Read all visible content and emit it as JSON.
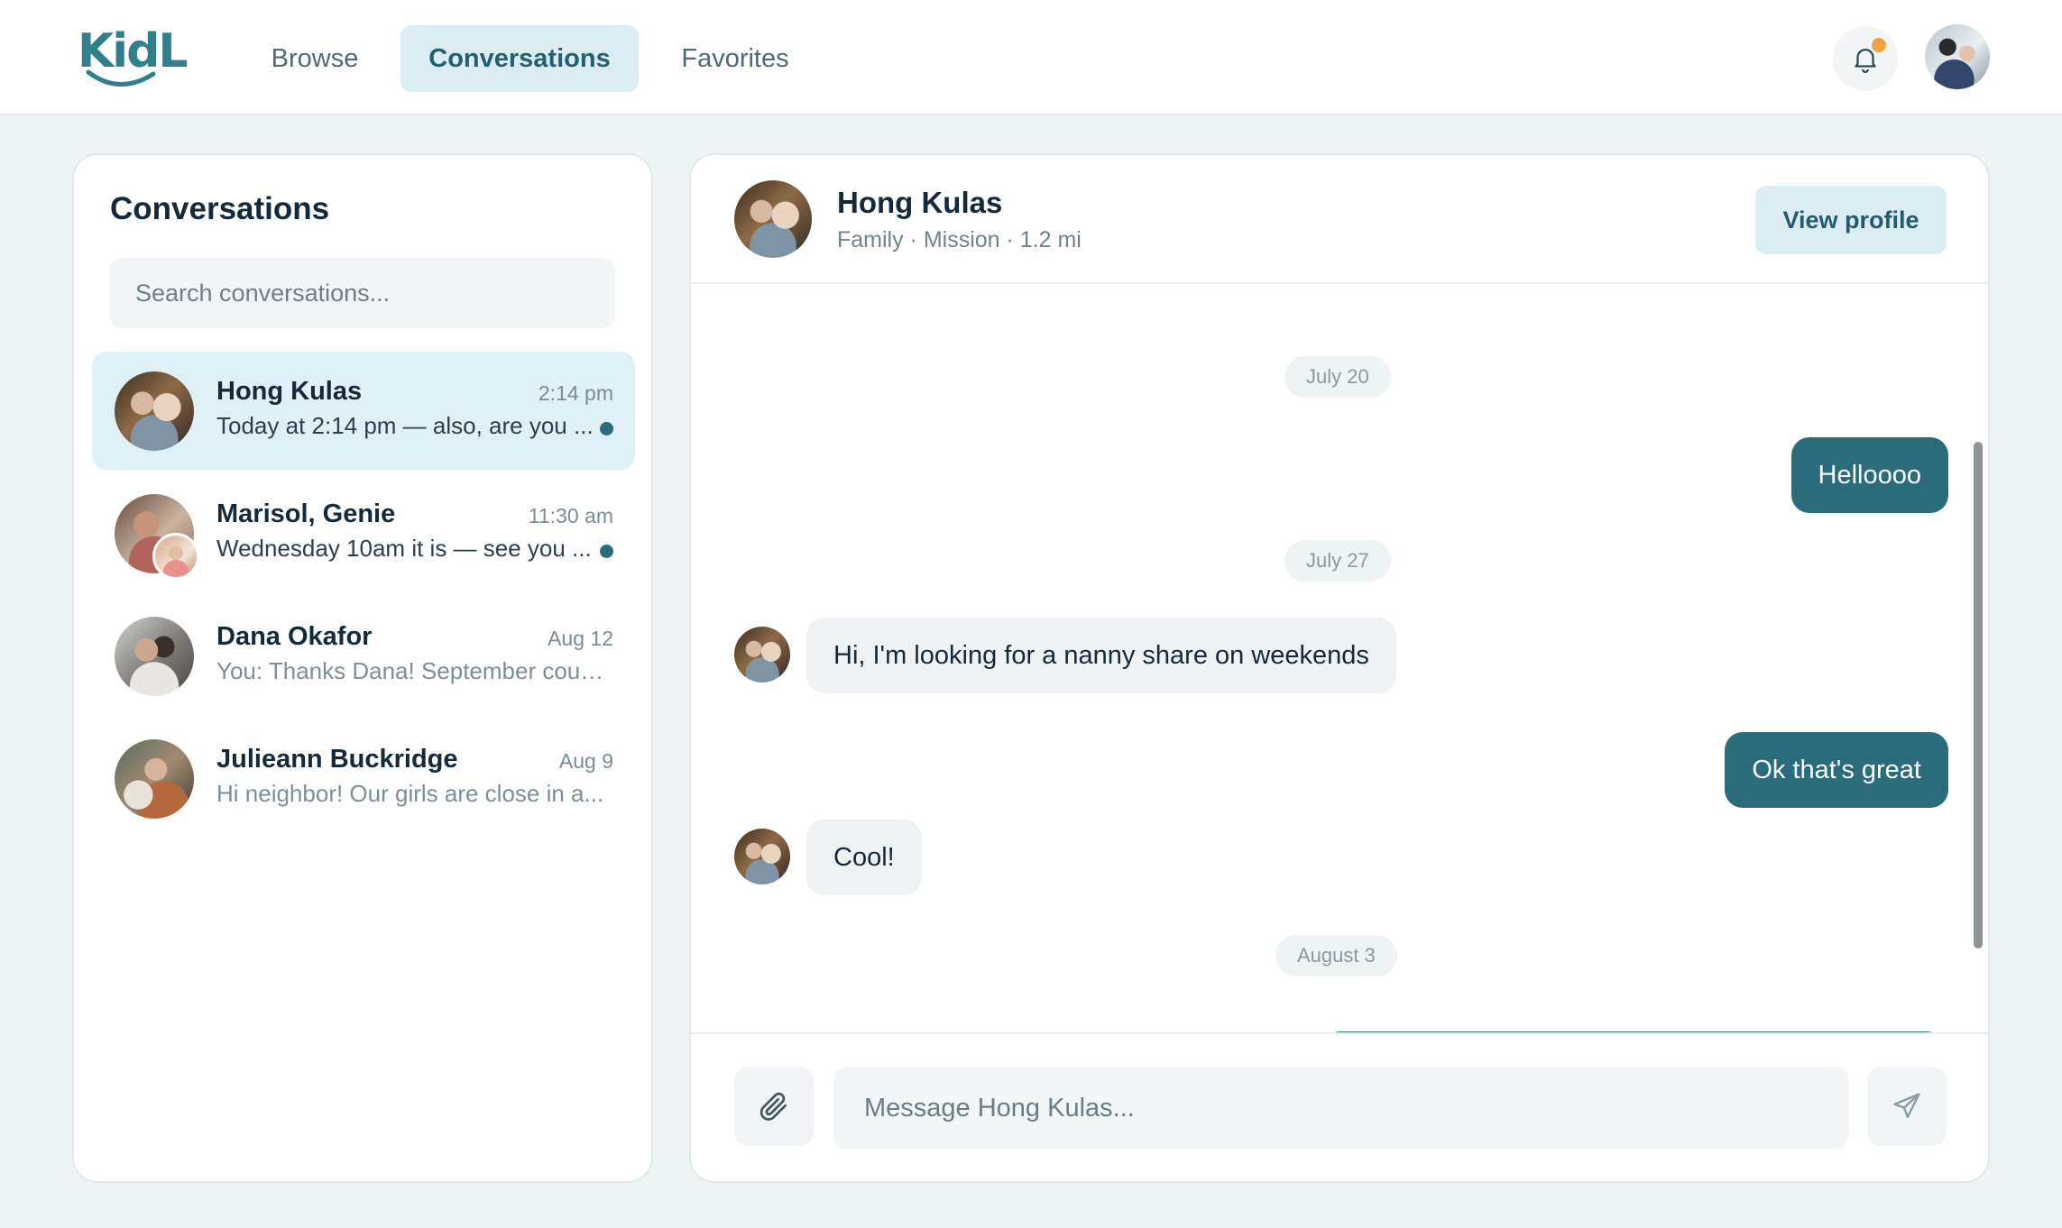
{
  "brand": {
    "logo_text": "KidL",
    "accent": "#2f7f8c"
  },
  "nav": {
    "items": [
      {
        "label": "Browse",
        "active": false
      },
      {
        "label": "Conversations",
        "active": true
      },
      {
        "label": "Favorites",
        "active": false
      }
    ]
  },
  "header": {
    "notifications_icon": "bell-icon",
    "has_unread_notification": true,
    "avatar": "user-avatar"
  },
  "sidebar": {
    "title": "Conversations",
    "search_placeholder": "Search conversations...",
    "conversations": [
      {
        "name": "Hong Kulas",
        "time": "2:14 pm",
        "preview": "Today at 2:14 pm — also, are you ...",
        "unread": true,
        "active": true
      },
      {
        "name": "Marisol, Genie",
        "time": "11:30 am",
        "preview": "Wednesday 10am it is — see you ...",
        "unread": true,
        "active": false
      },
      {
        "name": "Dana Okafor",
        "time": "Aug 12",
        "preview": "You: Thanks Dana! September coul...",
        "unread": false,
        "active": false
      },
      {
        "name": "Julieann Buckridge",
        "time": "Aug 9",
        "preview": "Hi neighbor! Our girls are close in a...",
        "unread": false,
        "active": false
      }
    ]
  },
  "chat": {
    "contact_name": "Hong Kulas",
    "contact_meta": "Family · Mission · 1.2 mi",
    "view_profile_label": "View profile",
    "messages": [
      {
        "type": "date",
        "text": "July 20"
      },
      {
        "type": "outgoing",
        "text": "Helloooo"
      },
      {
        "type": "date",
        "text": "July 27"
      },
      {
        "type": "incoming",
        "text": "Hi, I'm looking for a nanny share on weekends"
      },
      {
        "type": "outgoing",
        "text": "Ok that's great"
      },
      {
        "type": "incoming",
        "text": "Cool!"
      },
      {
        "type": "date",
        "text": "August 3"
      }
    ],
    "composer_placeholder": "Message Hong Kulas...",
    "attach_icon": "paperclip-icon",
    "send_icon": "send-icon"
  }
}
